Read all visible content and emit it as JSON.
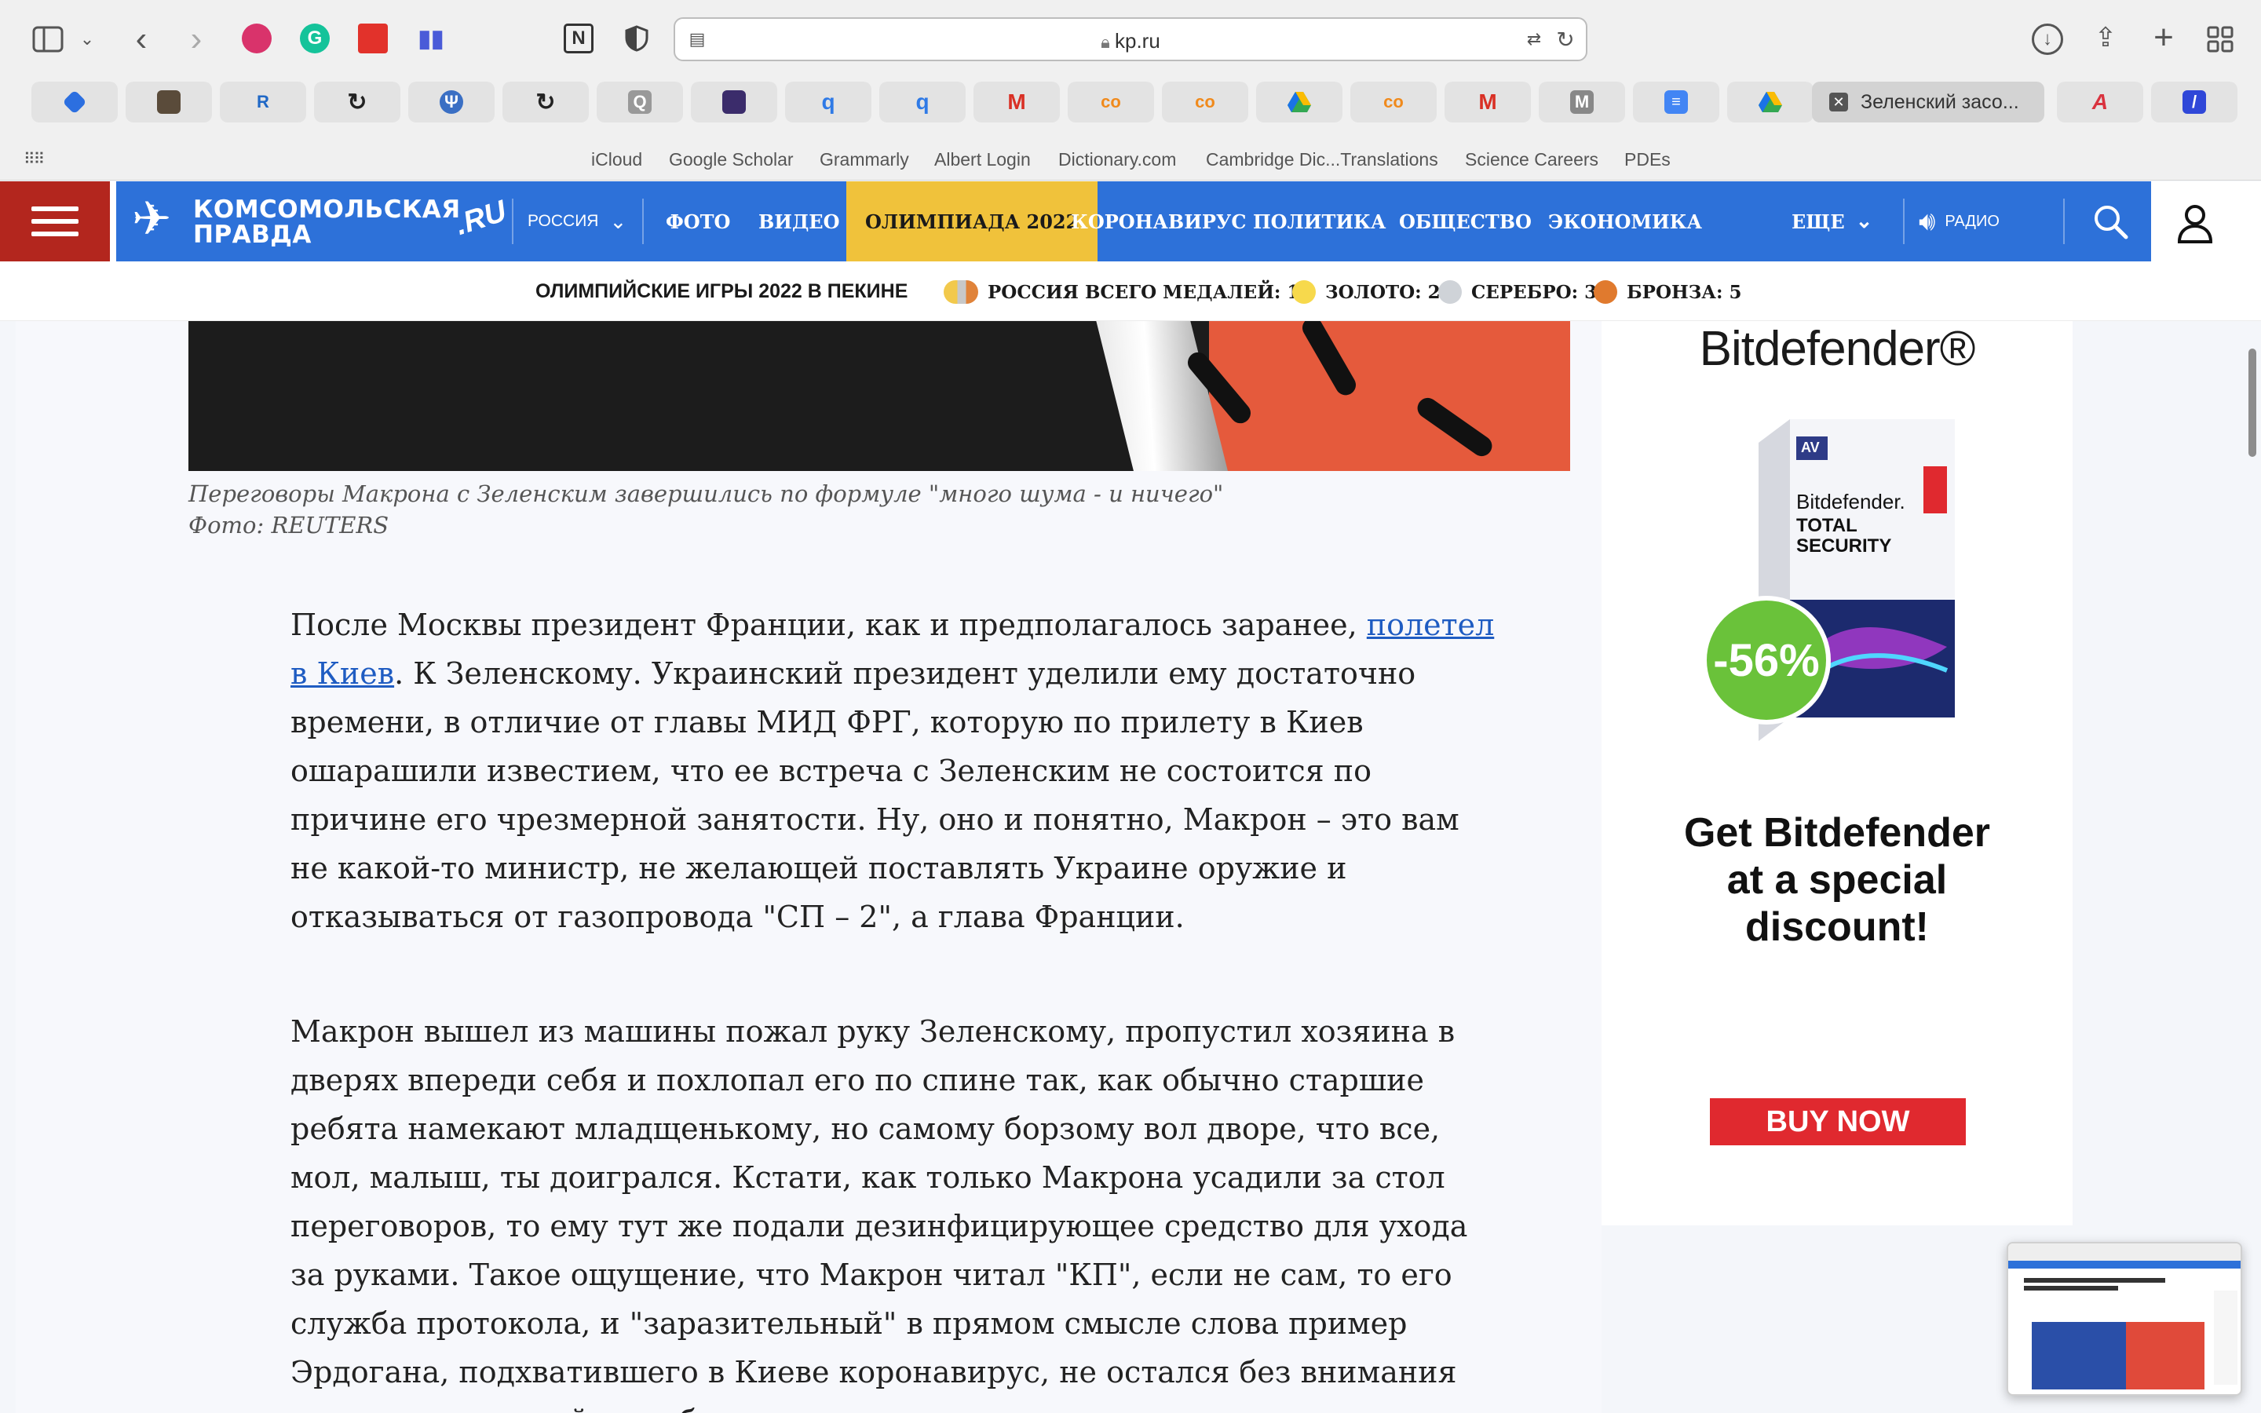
{
  "browser": {
    "url": "kp.ru",
    "active_tab_title": "Зеленский засо...",
    "favorites": [
      "iCloud",
      "Google Scholar",
      "Grammarly",
      "Albert Login",
      "Dictionary.com",
      "Cambridge Dic...Translations",
      "Science Careers",
      "PDEs"
    ],
    "pinned_tabs": [
      "perplexity",
      "book",
      "R",
      "loop",
      "psi",
      "loop",
      "Q",
      "feather",
      "q",
      "q",
      "M",
      "co",
      "co",
      "drive",
      "co",
      "M",
      "M",
      "docs",
      "drive"
    ],
    "colors": {
      "chrome_bg": "#f0f0f0"
    }
  },
  "site": {
    "logo_line1": "КОМСОМОЛЬСКАЯ",
    "logo_line2": "ПРАВДА",
    "logo_ru": ".RU",
    "region": "РОССИЯ",
    "nav": [
      "ФОТО",
      "ВИДЕО",
      "ОЛИМПИАДА 2022",
      "КОРОНАВИРУС",
      "ПОЛИТИКА",
      "ОБЩЕСТВО",
      "ЭКОНОМИКА"
    ],
    "more": "ЕЩЕ",
    "radio": "РАДИО",
    "colors": {
      "nav": "#2d71d9",
      "menu": "#b3261e",
      "olympics": "#f0c23b"
    }
  },
  "olympics": {
    "title": "ОЛИМПИЙСКИЕ ИГРЫ 2022 В ПЕКИНЕ",
    "total": "РОССИЯ ВСЕГО МЕДАЛЕЙ: 10",
    "gold": "ЗОЛОТО: 2",
    "silver": "СЕРЕБРО: 3",
    "bronze": "БРОНЗА: 5"
  },
  "article": {
    "caption": "Переговоры Макрона с Зеленским завершились по формуле \"много шума - и ничего\"",
    "photo_credit": "Фото: REUTERS",
    "p1_before": "После Москвы президент Франции, как и предполагалось заранее, ",
    "p1_link": "полетел в Киев",
    "p1_after": ". К Зеленскому. Украинский президент уделили ему достаточно времени, в отличие от главы МИД ФРГ, которую по прилету в Киев ошарашили известием, что ее встреча с Зеленским не состоится по причине его чрезмерной занятости. Ну, оно и понятно, Макрон – это вам не какой-то министр, не желающей поставлять Украине оружие и отказываться от газопровода \"СП – 2\", а глава Франции.",
    "p2": "Макрон вышел из машины пожал руку Зеленскому, пропустил хозяина в дверях впереди себя и похлопал его по спине так, как обычно старшие ребята намекают младщенькому, но самому борзому вол дворе, что все, мол, малыш, ты доигрался. Кстати, как только Макрона усадили за стол переговоров, то ему тут же подали дезинфицирующее средство для ухода за руками. Такое ощущение, что Макрон читал \"КП\", если не сам, то его служба протокола, и \"заразительный\" в прямом смысле слова пример Эрдогана, подхватившего в Киеве коронавирус, не остался без внимания специалистов этой службы."
  },
  "ad": {
    "brand": "Bitdefender®",
    "box_brand": "Bitdefender.",
    "box_product_1": "TOTAL",
    "box_product_2": "SECURITY",
    "box_badge": "AV",
    "discount": "-56%",
    "headline_1": "Get Bitdefender",
    "headline_2": "at a special",
    "headline_3": "discount!",
    "button": "BUY NOW",
    "colors": {
      "discount": "#6ac23a",
      "button": "#e0292f"
    }
  }
}
